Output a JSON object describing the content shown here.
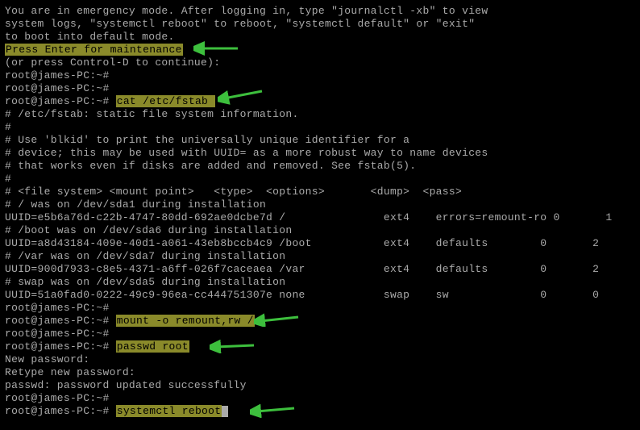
{
  "lines": {
    "l0": "You are in emergency mode. After logging in, type \"journalctl -xb\" to view",
    "l1": "system logs, \"systemctl reboot\" to reboot, \"systemctl default\" or \"exit\"",
    "l2": "to boot into default mode.",
    "l3_hl": "Press Enter for maintenance",
    "l4": "(or press Control-D to continue):",
    "l5": "root@james-PC:~#",
    "l6": "root@james-PC:~#",
    "l7_a": "root@james-PC:~# ",
    "l7_hl": "cat /etc/fstab ",
    "l8": "# /etc/fstab: static file system information.",
    "l9": "#",
    "l10": "# Use 'blkid' to print the universally unique identifier for a",
    "l11": "# device; this may be used with UUID= as a more robust way to name devices",
    "l12": "# that works even if disks are added and removed. See fstab(5).",
    "l13": "#",
    "l14": "# <file system> <mount point>   <type>  <options>       <dump>  <pass>",
    "l15": "# / was on /dev/sda1 during installation",
    "l16": "UUID=e5b6a76d-c22b-4747-80dd-692ae0dcbe7d /               ext4    errors=remount-ro 0       1",
    "l17": "# /boot was on /dev/sda6 during installation",
    "l18": "UUID=a8d43184-409e-40d1-a061-43eb8bccb4c9 /boot           ext4    defaults        0       2",
    "l19": "# /var was on /dev/sda7 during installation",
    "l20": "UUID=900d7933-c8e5-4371-a6ff-026f7caceaea /var            ext4    defaults        0       2",
    "l21": "# swap was on /dev/sda5 during installation",
    "l22": "UUID=51a0fad0-0222-49c9-96ea-cc444751307e none            swap    sw              0       0",
    "l23": "root@james-PC:~#",
    "l24_a": "root@james-PC:~# ",
    "l24_hl": "mount -o remount,rw /",
    "l25": "root@james-PC:~#",
    "l26_a": "root@james-PC:~# ",
    "l26_hl": "passwd root",
    "l27": "New password:",
    "l28": "Retype new password:",
    "l29": "passwd: password updated successfully",
    "l30": "root@james-PC:~#",
    "l31_a": "root@james-PC:~# ",
    "l31_hl": "systemctl reboot"
  }
}
